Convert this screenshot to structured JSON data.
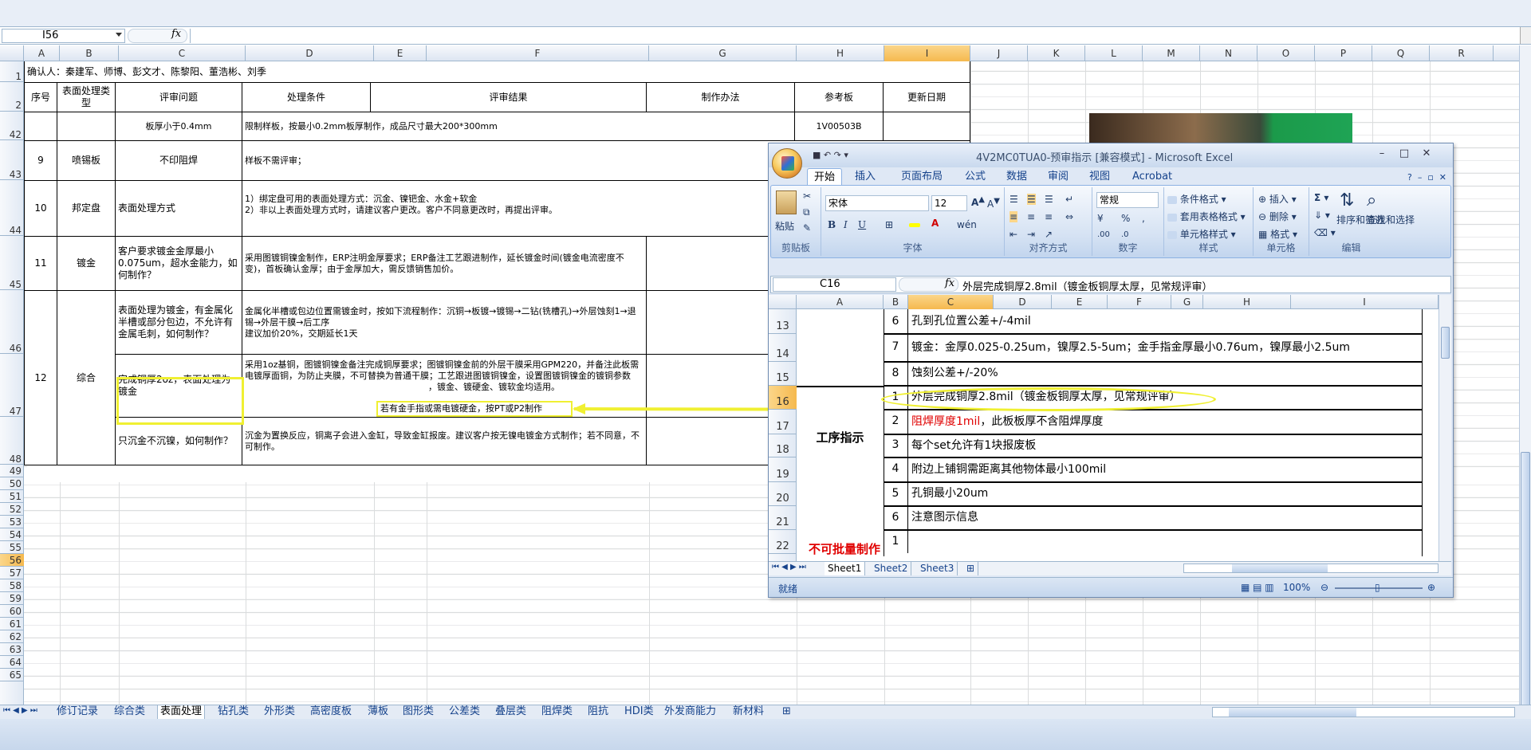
{
  "formula_bar": {
    "name_box": "I56",
    "fx": "fx"
  },
  "columns": [
    "A",
    "B",
    "C",
    "D",
    "E",
    "F",
    "G",
    "H",
    "I",
    "J",
    "K",
    "L",
    "M",
    "N",
    "O",
    "P",
    "Q",
    "R"
  ],
  "rows": [
    "1",
    "2",
    "42",
    "43",
    "44",
    "45",
    "46",
    "47",
    "48",
    "49",
    "50",
    "51",
    "52",
    "53",
    "54",
    "55",
    "56",
    "57",
    "58",
    "59",
    "60",
    "61",
    "62",
    "63",
    "64",
    "65"
  ],
  "table": {
    "confirm": "确认人：秦建军、师博、彭文才、陈黎阳、董浩彬、刘季",
    "headers": {
      "no": "序号",
      "type": "表面处理类型",
      "issue": "评审问题",
      "cond": "处理条件",
      "result": "评审结果",
      "method": "制作办法",
      "ref": "参考板",
      "date": "更新日期"
    },
    "r42": {
      "issue": "板厚小于0.4mm",
      "cond": "限制样板，按最小0.2mm板厚制作，成品尺寸最大200*300mm",
      "ref": "1V00503B"
    },
    "r43": {
      "no": "9",
      "type": "喷锡板",
      "issue": "不印阻焊",
      "cond": "样板不需评审；"
    },
    "r44": {
      "no": "10",
      "type": "邦定盘",
      "issue": "表面处理方式",
      "cond1": "1）绑定盘可用的表面处理方式：沉金、镍钯金、水金+软金",
      "cond2": "2）非以上表面处理方式时，请建议客户更改。客户不同意更改时，再提出评审。"
    },
    "r45": {
      "no": "11",
      "type": "镀金",
      "issue": "客户要求镀金金厚最小0.075um，超水金能力，如何制作？",
      "cond": "采用图镀铜镍金制作，ERP注明金厚要求；ERP备注工艺跟进制作，延长镀金时间(镀金电流密度不变)，首板确认金厚；由于金厚加大，需反馈销售加价。"
    },
    "r46": {
      "issue": "表面处理为镀金，有金属化半槽或部分包边，不允许有金属毛刺，如何制作？",
      "cond": "金属化半槽或包边位置需镀金时，按如下流程制作：沉铜→板镀→镀锡→二钻(铣槽孔)→外层蚀刻1→退锡→外层干膜→后工序\n建议加价20%，交期延长1天"
    },
    "r47": {
      "no": "12",
      "type": "综合",
      "issue": "完成铜厚2oz，表面处理为镀金",
      "cond": "采用1oz基铜，图镀铜镍金备注完成铜厚要求；图镀铜镍金前的外层干膜采用GPM220，并备注此板需电镀厚面铜，为防止夹膜，不可替换为普通干膜；工艺跟进图镀铜镍金，设置图镀铜镍金的镀铜参数",
      "cond_tail": "、镀软金均适用。",
      "callout": "若有金手指或需电镀硬金，按PT或P2制作",
      "callout_tail": "，镀金、镀硬金"
    },
    "r48": {
      "issue": "只沉金不沉镍，如何制作？",
      "cond": "沉金为置换反应，铜离子会进入金缸，导致金缸报废。建议客户按无镍电镀金方式制作；若不同意，不可制作。"
    }
  },
  "window": {
    "title": "4V2MC0TUA0-预审指示 [兼容模式] - Microsoft Excel",
    "tabs": [
      "开始",
      "插入",
      "页面布局",
      "公式",
      "数据",
      "审阅",
      "视图",
      "Acrobat"
    ],
    "ribbon": {
      "paste": "粘贴",
      "clipboard": "剪贴板",
      "font_name": "宋体",
      "font_size": "12",
      "font": "字体",
      "align": "对齐方式",
      "number_format": "常规",
      "number": "数字",
      "cond_format": "条件格式",
      "table_format": "套用表格格式",
      "cell_style": "单元格样式",
      "styles": "样式",
      "insert": "插入",
      "delete": "删除",
      "format": "格式",
      "cells": "单元格",
      "sort": "排序和筛选",
      "find": "查找和选择",
      "editing": "编辑"
    },
    "name_box": "C16",
    "formula": "外层完成铜厚2.8mil（镀金板铜厚太厚，见常规评审）",
    "columns": [
      "A",
      "B",
      "C",
      "D",
      "E",
      "F",
      "G",
      "H",
      "I"
    ],
    "rows": [
      "13",
      "14",
      "15",
      "16",
      "17",
      "18",
      "19",
      "20",
      "21",
      "22"
    ],
    "cells": {
      "r13_num": "6",
      "r13": "孔到孔位置公差+/-4mil",
      "r14_num": "7",
      "r14": "镀金：金厚0.025-0.25um，镍厚2.5-5um；金手指金厚最小0.76um，镍厚最小2.5um",
      "r15_num": "8",
      "r15": "蚀刻公差+/-20%",
      "r16_num": "1",
      "r16": "外层完成铜厚2.8mil（镀金板铜厚太厚，见常规评审）",
      "r17_num": "2",
      "r17_red": "阻焊厚度1mil",
      "r17": "，此板板厚不含阻焊厚度",
      "r18_num": "3",
      "r18": "每个set允许有1块报废板",
      "r19_num": "4",
      "r19": "附边上铺铜需距离其他物体最小100mil",
      "r20_num": "5",
      "r20": "孔铜最小20um",
      "r21_num": "6",
      "r21": "注意图示信息",
      "r22_num": "1",
      "process_label": "工序指示",
      "r22_label": "不可批量制作"
    },
    "sheets": [
      "Sheet1",
      "Sheet2",
      "Sheet3"
    ],
    "status": "就绪",
    "zoom": "100%"
  },
  "sheet_tabs": [
    "修订记录",
    "综合类",
    "表面处理",
    "钻孔类",
    "外形类",
    "高密度板",
    "薄板",
    "图形类",
    "公差类",
    "叠层类",
    "阻焊类",
    "阻抗",
    "HDI类",
    "外发商能力",
    "新材料"
  ],
  "colors": {
    "highlight": "#f0f032",
    "red_text": "#e00000",
    "ribbon_blue": "#15428b"
  }
}
